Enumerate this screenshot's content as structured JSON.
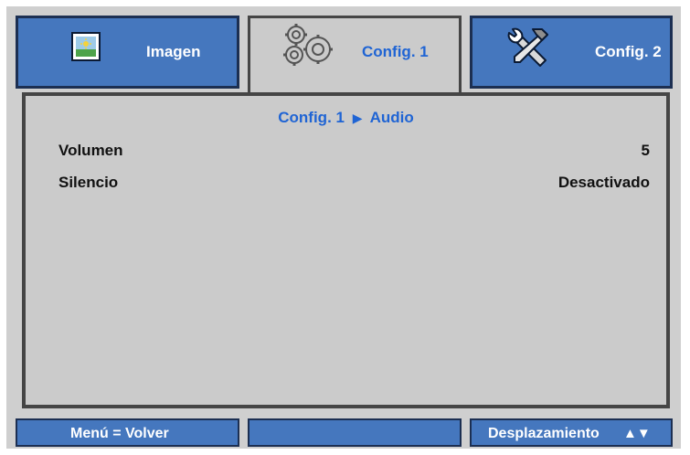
{
  "tabs": [
    {
      "label": "Imagen",
      "icon": "image-icon",
      "active": false
    },
    {
      "label": "Config. 1",
      "icon": "gears-icon",
      "active": true
    },
    {
      "label": "Config. 2",
      "icon": "tools-icon",
      "active": false
    }
  ],
  "breadcrumb": {
    "parent": "Config. 1",
    "separator": "▶",
    "current": "Audio"
  },
  "settings": [
    {
      "name": "Volumen",
      "value": "5"
    },
    {
      "name": "Silencio",
      "value": "Desactivado"
    }
  ],
  "footer": {
    "left": "Menú = Volver",
    "middle": "",
    "right": "Desplazamiento",
    "arrows": "▲▼"
  },
  "colors": {
    "accent_blue": "#4577be",
    "text_blue": "#1f64d4",
    "panel_gray": "#cbcbcb",
    "border_dark": "#454545"
  }
}
